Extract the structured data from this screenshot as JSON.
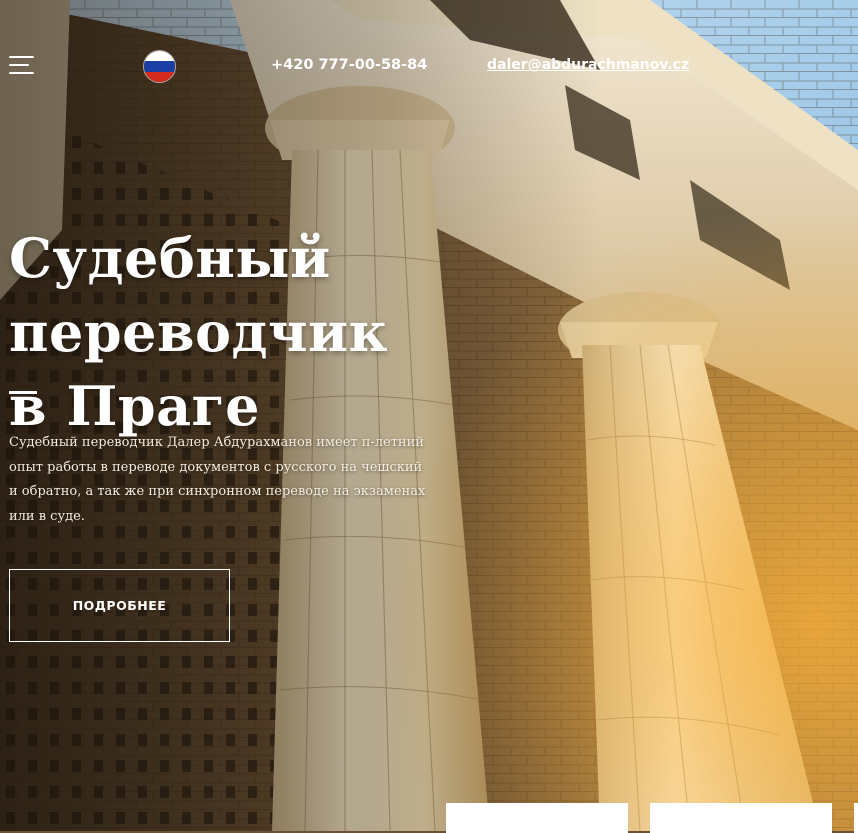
{
  "header": {
    "menu_icon": "hamburger-menu-icon",
    "language": {
      "icon": "russian-flag-icon",
      "colors": [
        "#ffffff",
        "#1c3fa6",
        "#d52b1e"
      ]
    },
    "phone": "+420 777-00-58-84",
    "email": "daler@abdurachmanov.cz"
  },
  "hero": {
    "title_line1": "Судебный переводчик",
    "title_line2": "в Праге",
    "description": "Судебный переводчик Далер Абдурахманов имеет п-летний опыт работы в переводе документов с русского на чешский и обратно, а так же при синхронном переводе на экзаменах или в суде.",
    "button_label": "ПОДРОБНЕЕ",
    "background": "building-columns-photo"
  },
  "colors": {
    "text": "#ffffff",
    "sky": "#8fc2e6",
    "stone": "#e8d3a8",
    "brick": "#6e5535"
  }
}
